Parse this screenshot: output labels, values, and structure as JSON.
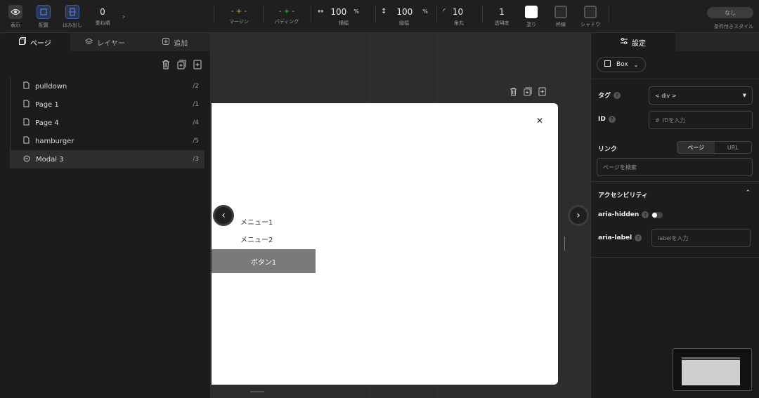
{
  "toolbar": {
    "display_label": "表示",
    "layout_label": "配置",
    "overflow_label": "はみ出し",
    "zindex_value": "0",
    "zindex_label": "重ね順",
    "margin_label": "マージン",
    "padding_label": "パディング",
    "width_value": "100",
    "width_unit": "%",
    "width_label": "横幅",
    "height_value": "100",
    "height_unit": "%",
    "height_label": "縦幅",
    "radius_value": "10",
    "radius_label": "角丸",
    "opacity_value": "1",
    "opacity_label": "透明度",
    "fill_label": "塗り",
    "border_label": "枠線",
    "shadow_label": "シャドウ",
    "conditional_value": "なし",
    "conditional_label": "条件付きスタイル",
    "fill_color": "#ffffff",
    "accent_margin": "#e0a040",
    "accent_padding": "#40c040"
  },
  "left_panel": {
    "tabs": [
      {
        "label": "ページ",
        "icon": "pages-icon"
      },
      {
        "label": "レイヤー",
        "icon": "layers-icon"
      },
      {
        "label": "追加",
        "icon": "add-icon"
      }
    ],
    "pages": [
      {
        "name": "pulldown",
        "slug": "/2",
        "icon": "page-icon"
      },
      {
        "name": "Page 1",
        "slug": "/1",
        "icon": "page-icon"
      },
      {
        "name": "Page 4",
        "slug": "/4",
        "icon": "page-icon"
      },
      {
        "name": "hamburger",
        "slug": "/5",
        "icon": "page-icon"
      },
      {
        "name": "Modal 3",
        "slug": "/3",
        "icon": "modal-icon",
        "selected": true
      }
    ]
  },
  "canvas": {
    "menu_items": [
      "メニュー1",
      "メニュー2"
    ],
    "button_label": "ボタン1",
    "close_glyph": "✕"
  },
  "right_panel": {
    "tab_label": "設定",
    "element_type": "Box",
    "tag_label": "タグ",
    "tag_value": "< div >",
    "id_label": "ID",
    "id_placeholder": "IDを入力",
    "link_label": "リンク",
    "link_modes": [
      "ページ",
      "URL"
    ],
    "link_search_placeholder": "ページを検索",
    "a11y_title": "アクセシビリティ",
    "aria_hidden_label": "aria-hidden",
    "aria_label_label": "aria-label",
    "aria_label_placeholder": "labelを入力"
  }
}
